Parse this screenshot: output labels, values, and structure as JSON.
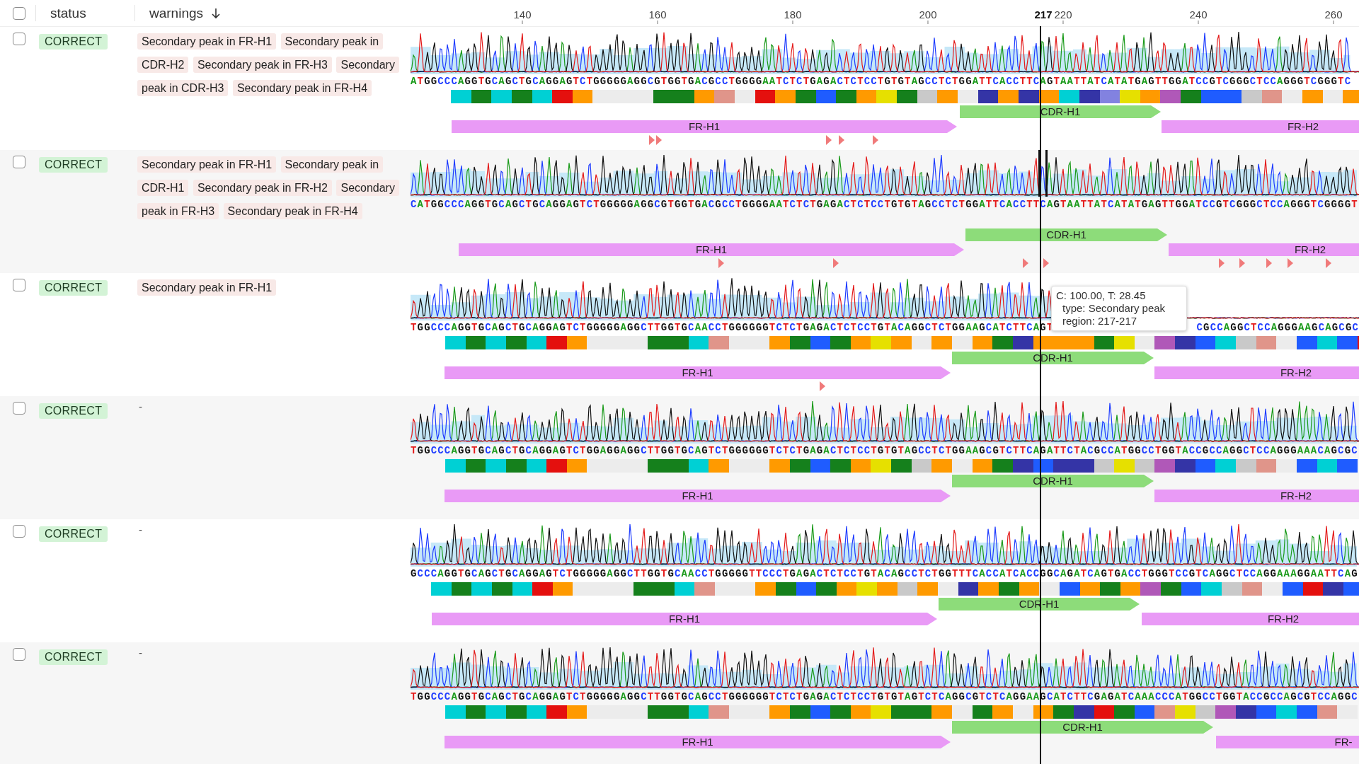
{
  "table": {
    "header": {
      "checked": false,
      "columns": [
        {
          "label": "status",
          "sorted": false
        },
        {
          "label": "warnings",
          "sorted": true
        }
      ]
    },
    "axis": {
      "ticks": [
        {
          "label": "140",
          "selected": false
        },
        {
          "label": "160",
          "selected": false
        },
        {
          "label": "180",
          "selected": false
        },
        {
          "label": "200",
          "selected": false
        },
        {
          "label": "217",
          "selected": true
        },
        {
          "label": "220",
          "selected": false
        },
        {
          "label": "240",
          "selected": false
        },
        {
          "label": "260",
          "selected": false
        }
      ]
    },
    "rows": [
      {
        "checked": false,
        "status": "CORRECT",
        "warnings": [
          "Secondary peak in FR-H1",
          "Secondary peak in CDR-H2",
          "Secondary peak in FR-H3",
          "Secondary peak in CDR-H3",
          "Secondary peak in FR-H4"
        ],
        "position_selected": false,
        "sequence": "ATGGCCCAGGTGCAGCTGCAGGAGTCTGGGGGAGGCGTGGTGACGCCTGGGGAATCTCTGAGACTCTCCTGTGTAGCCTCTGGATTCACCTTCAGTAATTATCATATGAGTTGGATCCGTCGGGCTCCAGGGTCGGGTC",
        "residues": [
          {
            "color": "#00d0d4"
          },
          {
            "color": "#15801c"
          },
          {
            "color": "#00d0d4"
          },
          {
            "color": "#15801c"
          },
          {
            "color": "#00d0d4"
          },
          {
            "color": "#e4100e"
          },
          {
            "color": "#ff9a00"
          },
          {
            "color": "#ececec"
          },
          {
            "color": "#ececec"
          },
          {
            "color": "#ececec"
          },
          {
            "color": "#15801c"
          },
          {
            "color": "#15801c"
          },
          {
            "color": "#ff9a00"
          },
          {
            "color": "#e0958a"
          },
          {
            "color": "#ececec"
          },
          {
            "color": "#e4100e"
          },
          {
            "color": "#ff9a00"
          },
          {
            "color": "#15801c"
          },
          {
            "color": "#1f5cff"
          },
          {
            "color": "#15801c"
          },
          {
            "color": "#ff9a00"
          },
          {
            "color": "#e6e000"
          },
          {
            "color": "#15801c"
          },
          {
            "color": "#c9c9c9"
          },
          {
            "color": "#ff9a00"
          },
          {
            "color": "#ececec"
          },
          {
            "color": "#3434a6"
          },
          {
            "color": "#ff9a00"
          },
          {
            "color": "#3434a6"
          },
          {
            "color": "#ff9a00"
          },
          {
            "color": "#00d0d4"
          },
          {
            "color": "#3434a6"
          },
          {
            "color": "#8282e0"
          },
          {
            "color": "#e6e000"
          },
          {
            "color": "#ff9a00"
          },
          {
            "color": "#b058b8"
          },
          {
            "color": "#15801c"
          },
          {
            "color": "#1f5cff"
          },
          {
            "color": "#1f5cff"
          },
          {
            "color": "#c9c9c9"
          },
          {
            "color": "#e0958a"
          },
          {
            "color": "#ececec"
          },
          {
            "color": "#ff9a00"
          },
          {
            "color": "#ececec"
          },
          {
            "color": "#ff9a00"
          }
        ],
        "regions": [
          {
            "label": "FR-H1",
            "kind": "framework"
          },
          {
            "label": "CDR-H1",
            "kind": "cdr"
          },
          {
            "label": "FR-H2",
            "kind": "framework"
          }
        ]
      },
      {
        "checked": false,
        "status": "CORRECT",
        "warnings": [
          "Secondary peak in FR-H1",
          "Secondary peak in CDR-H1",
          "Secondary peak in FR-H2",
          "Secondary peak in FR-H3",
          "Secondary peak in FR-H4"
        ],
        "position_selected": true,
        "sequence": "CATGGCCCAGGTGCAGCTGCAGGAGTCTGGGGGAGGCGTGGTGACGCCTGGGGAATCTCTGAGACTCTCCTGTGTAGCCTCTGGATTCACCTTCAGTAATTATCATATGAGTTGGATCCGTCGGGCTCCAGGGTCGGGGT",
        "regions": [
          {
            "label": "FR-H1",
            "kind": "framework"
          },
          {
            "label": "CDR-H1",
            "kind": "cdr"
          },
          {
            "label": "FR-H2",
            "kind": "framework"
          }
        ]
      },
      {
        "checked": false,
        "status": "CORRECT",
        "warnings": [
          "Secondary peak in FR-H1"
        ],
        "position_selected": false,
        "sequence": "TGGCCCAGGTGCAGCTGCAGGAGTCTGGGGGAGGCTTGGTGCAACCTGGGGGGTCTCTGAGACTCTCCTGTACAGGCTCTGGAAGCATCTTCAGT",
        "sequence_tail": "CGCCAGGCTCCAGGGAAGCAGCGC",
        "residues": [
          {
            "color": "#00d0d4"
          },
          {
            "color": "#15801c"
          },
          {
            "color": "#00d0d4"
          },
          {
            "color": "#15801c"
          },
          {
            "color": "#00d0d4"
          },
          {
            "color": "#e4100e"
          },
          {
            "color": "#ff9a00"
          },
          {
            "color": "#ececec"
          },
          {
            "color": "#ececec"
          },
          {
            "color": "#ececec"
          },
          {
            "color": "#15801c"
          },
          {
            "color": "#15801c"
          },
          {
            "color": "#00d0d4"
          },
          {
            "color": "#e0958a"
          },
          {
            "color": "#ececec"
          },
          {
            "color": "#ececec"
          },
          {
            "color": "#ff9a00"
          },
          {
            "color": "#15801c"
          },
          {
            "color": "#1f5cff"
          },
          {
            "color": "#15801c"
          },
          {
            "color": "#ff9a00"
          },
          {
            "color": "#e6e000"
          },
          {
            "color": "#ff9a00"
          },
          {
            "color": "#ececec"
          },
          {
            "color": "#ff9a00"
          },
          {
            "color": "#ececec"
          },
          {
            "color": "#ff9a00"
          },
          {
            "color": "#15801c"
          },
          {
            "color": "#3434a6"
          },
          {
            "color": "#ff9a00"
          },
          {
            "color": "#ff9a00"
          },
          {
            "color": "#ff9a00"
          },
          {
            "color": "#15801c"
          },
          {
            "color": "#e6e000"
          },
          {
            "color": "#ececec"
          },
          {
            "color": "#b058b8"
          },
          {
            "color": "#3434a6"
          },
          {
            "color": "#1f5cff"
          },
          {
            "color": "#00d0d4"
          },
          {
            "color": "#c9c9c9"
          },
          {
            "color": "#e0958a"
          },
          {
            "color": "#ececec"
          },
          {
            "color": "#1f5cff"
          },
          {
            "color": "#00d0d4"
          },
          {
            "color": "#1f5cff"
          },
          {
            "color": "#e4100e"
          }
        ],
        "regions": [
          {
            "label": "FR-H1",
            "kind": "framework"
          },
          {
            "label": "CDR-H1",
            "kind": "cdr"
          },
          {
            "label": "FR-H2",
            "kind": "framework"
          }
        ]
      },
      {
        "checked": false,
        "status": "CORRECT",
        "no_warnings_text": "-",
        "position_selected": false,
        "sequence": "TGGCCCAGGTGCAGCTGCAGGAGTCTGGAGGAGGCTTGGTGCAGTCTGGGGGGTCTCTGAGACTCTCCTGTGTAGCCTCTGGAAGCGTCTTCAGATTCTACGCCATGGCCTGGTACCGCCAGGCTCCAGGGAAACAGCGC",
        "residues": [
          {
            "color": "#00d0d4"
          },
          {
            "color": "#15801c"
          },
          {
            "color": "#00d0d4"
          },
          {
            "color": "#15801c"
          },
          {
            "color": "#00d0d4"
          },
          {
            "color": "#e4100e"
          },
          {
            "color": "#ff9a00"
          },
          {
            "color": "#ececec"
          },
          {
            "color": "#ececec"
          },
          {
            "color": "#ececec"
          },
          {
            "color": "#15801c"
          },
          {
            "color": "#15801c"
          },
          {
            "color": "#00d0d4"
          },
          {
            "color": "#ff9a00"
          },
          {
            "color": "#ececec"
          },
          {
            "color": "#ececec"
          },
          {
            "color": "#ff9a00"
          },
          {
            "color": "#15801c"
          },
          {
            "color": "#1f5cff"
          },
          {
            "color": "#15801c"
          },
          {
            "color": "#ff9a00"
          },
          {
            "color": "#e6e000"
          },
          {
            "color": "#15801c"
          },
          {
            "color": "#c9c9c9"
          },
          {
            "color": "#ff9a00"
          },
          {
            "color": "#ececec"
          },
          {
            "color": "#ff9a00"
          },
          {
            "color": "#15801c"
          },
          {
            "color": "#3434a6"
          },
          {
            "color": "#1f5cff"
          },
          {
            "color": "#3434a6"
          },
          {
            "color": "#3434a6"
          },
          {
            "color": "#c9c9c9"
          },
          {
            "color": "#e6e000"
          },
          {
            "color": "#c9c9c9"
          },
          {
            "color": "#b058b8"
          },
          {
            "color": "#3434a6"
          },
          {
            "color": "#1f5cff"
          },
          {
            "color": "#00d0d4"
          },
          {
            "color": "#c9c9c9"
          },
          {
            "color": "#e0958a"
          },
          {
            "color": "#ececec"
          },
          {
            "color": "#1f5cff"
          },
          {
            "color": "#00d0d4"
          },
          {
            "color": "#1f5cff"
          }
        ],
        "regions": [
          {
            "label": "FR-H1",
            "kind": "framework"
          },
          {
            "label": "CDR-H1",
            "kind": "cdr"
          },
          {
            "label": "FR-H2",
            "kind": "framework"
          }
        ]
      },
      {
        "checked": false,
        "status": "CORRECT",
        "no_warnings_text": "-",
        "position_selected": false,
        "sequence": "GCCCAGGTGCAGCTGCAGGAGTCTGGGGGAGGCTTGGTGCAACCTGGGGGTTCCCTGAGACTCTCCTGTACAGCCTCTGGTTTCACCATCACCGGCAGATCAGTGACCTGGGTCCGTCAGGCTCCAGGAAAGGAATTCAG",
        "residues": [
          {
            "color": "#00d0d4"
          },
          {
            "color": "#15801c"
          },
          {
            "color": "#00d0d4"
          },
          {
            "color": "#15801c"
          },
          {
            "color": "#00d0d4"
          },
          {
            "color": "#e4100e"
          },
          {
            "color": "#ff9a00"
          },
          {
            "color": "#ececec"
          },
          {
            "color": "#ececec"
          },
          {
            "color": "#ececec"
          },
          {
            "color": "#15801c"
          },
          {
            "color": "#15801c"
          },
          {
            "color": "#00d0d4"
          },
          {
            "color": "#e0958a"
          },
          {
            "color": "#ececec"
          },
          {
            "color": "#ececec"
          },
          {
            "color": "#ff9a00"
          },
          {
            "color": "#15801c"
          },
          {
            "color": "#1f5cff"
          },
          {
            "color": "#15801c"
          },
          {
            "color": "#ff9a00"
          },
          {
            "color": "#e6e000"
          },
          {
            "color": "#ff9a00"
          },
          {
            "color": "#c9c9c9"
          },
          {
            "color": "#ff9a00"
          },
          {
            "color": "#ececec"
          },
          {
            "color": "#3434a6"
          },
          {
            "color": "#ff9a00"
          },
          {
            "color": "#15801c"
          },
          {
            "color": "#ff9a00"
          },
          {
            "color": "#ececec"
          },
          {
            "color": "#1f5cff"
          },
          {
            "color": "#ff9a00"
          },
          {
            "color": "#15801c"
          },
          {
            "color": "#ff9a00"
          },
          {
            "color": "#b058b8"
          },
          {
            "color": "#15801c"
          },
          {
            "color": "#1f5cff"
          },
          {
            "color": "#00d0d4"
          },
          {
            "color": "#c9c9c9"
          },
          {
            "color": "#e0958a"
          },
          {
            "color": "#ececec"
          },
          {
            "color": "#1f5cff"
          },
          {
            "color": "#e4100e"
          },
          {
            "color": "#3434a6"
          },
          {
            "color": "#1f5cff"
          }
        ],
        "regions": [
          {
            "label": "FR-H1",
            "kind": "framework"
          },
          {
            "label": "CDR-H1",
            "kind": "cdr"
          },
          {
            "label": "FR-H2",
            "kind": "framework"
          }
        ]
      },
      {
        "checked": false,
        "status": "CORRECT",
        "no_warnings_text": "-",
        "position_selected": false,
        "sequence": "TGGCCCAGGTGCAGCTGCAGGAGTCTGGGGGAGGCTTGGTGCAGCCTGGGGGGTCTCTGAGACTCTCCTGTGTAGTCTCAGGCGTCTCAGGAAGCATCTTCGAGATCAAACCCATGGCCTGGTACCGCCAGCGTCCAGGC",
        "residues": [
          {
            "color": "#00d0d4"
          },
          {
            "color": "#15801c"
          },
          {
            "color": "#00d0d4"
          },
          {
            "color": "#15801c"
          },
          {
            "color": "#00d0d4"
          },
          {
            "color": "#e4100e"
          },
          {
            "color": "#ff9a00"
          },
          {
            "color": "#ececec"
          },
          {
            "color": "#ececec"
          },
          {
            "color": "#ececec"
          },
          {
            "color": "#15801c"
          },
          {
            "color": "#15801c"
          },
          {
            "color": "#00d0d4"
          },
          {
            "color": "#e0958a"
          },
          {
            "color": "#ececec"
          },
          {
            "color": "#ececec"
          },
          {
            "color": "#ff9a00"
          },
          {
            "color": "#15801c"
          },
          {
            "color": "#1f5cff"
          },
          {
            "color": "#15801c"
          },
          {
            "color": "#ff9a00"
          },
          {
            "color": "#e6e000"
          },
          {
            "color": "#15801c"
          },
          {
            "color": "#15801c"
          },
          {
            "color": "#ff9a00"
          },
          {
            "color": "#ececec"
          },
          {
            "color": "#15801c"
          },
          {
            "color": "#ff9a00"
          },
          {
            "color": "#ececec"
          },
          {
            "color": "#ff9a00"
          },
          {
            "color": "#15801c"
          },
          {
            "color": "#3434a6"
          },
          {
            "color": "#e4100e"
          },
          {
            "color": "#15801c"
          },
          {
            "color": "#1f5cff"
          },
          {
            "color": "#e0958a"
          },
          {
            "color": "#e6e000"
          },
          {
            "color": "#c9c9c9"
          },
          {
            "color": "#b058b8"
          },
          {
            "color": "#3434a6"
          },
          {
            "color": "#1f5cff"
          },
          {
            "color": "#00d0d4"
          },
          {
            "color": "#1f5cff"
          },
          {
            "color": "#e0958a"
          },
          {
            "color": "#ececec"
          }
        ],
        "regions": [
          {
            "label": "FR-H1",
            "kind": "framework"
          },
          {
            "label": "CDR-H1",
            "kind": "cdr"
          },
          {
            "label": "FR-",
            "kind": "framework"
          }
        ]
      }
    ]
  },
  "tooltip": {
    "lines": [
      "C: 100.00, T: 28.45",
      "type: Secondary peak",
      "region: 217-217"
    ]
  }
}
